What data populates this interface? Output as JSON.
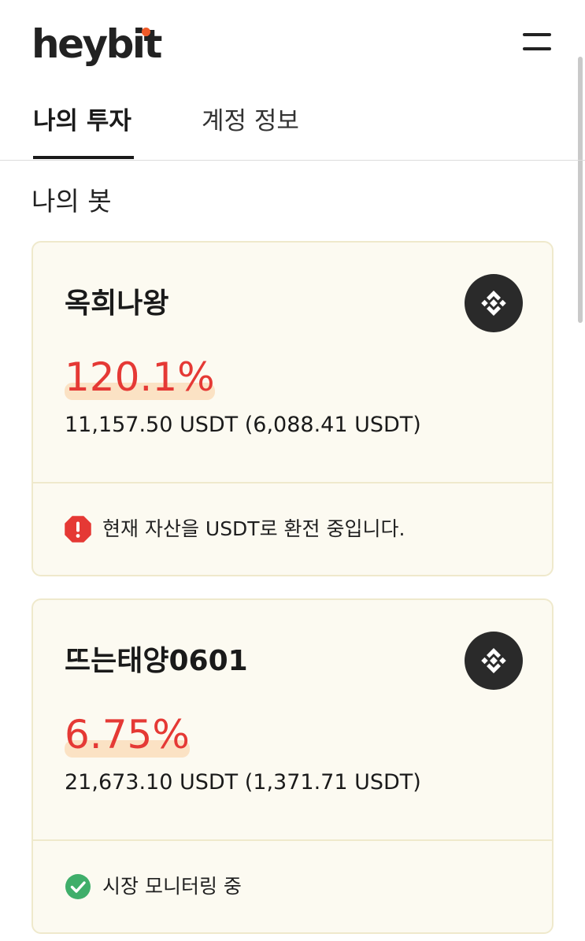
{
  "header": {
    "logo": "heybit",
    "menu_icon": "hamburger-menu-icon"
  },
  "tabs": [
    {
      "label": "나의 투자",
      "active": true
    },
    {
      "label": "계정 정보",
      "active": false
    }
  ],
  "section": {
    "title": "나의 봇"
  },
  "bots": [
    {
      "name": "옥희나왕",
      "exchange_icon": "binance-icon",
      "return_pct": "120.1%",
      "amount": "11,157.50 USDT (6,088.41 USDT)",
      "status_icon": "error-octagon-icon",
      "status_text": "현재 자산을 USDT로 환전 중입니다."
    },
    {
      "name": "뜨는태양0601",
      "exchange_icon": "binance-icon",
      "return_pct": "6.75%",
      "amount": "21,673.10 USDT (1,371.71 USDT)",
      "status_icon": "check-circle-icon",
      "status_text": "시장 모니터링 중"
    }
  ],
  "colors": {
    "accent_red": "#e53935",
    "card_bg": "#fcfaf1",
    "card_border": "#efe9cc",
    "success_green": "#3fae6a",
    "logo_dot": "#f05a28"
  }
}
